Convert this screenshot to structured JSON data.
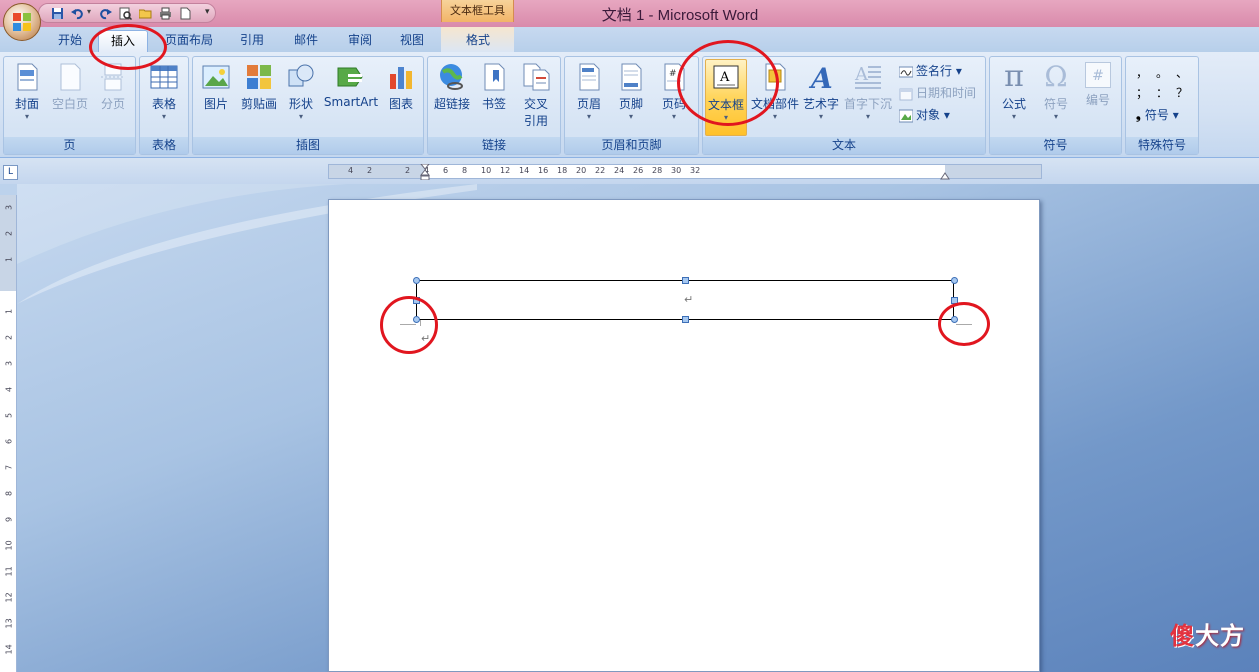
{
  "window": {
    "title": "文档 1 - Microsoft Word",
    "context_tools_label": "文本框工具"
  },
  "tabs": [
    {
      "label": "开始",
      "active": false
    },
    {
      "label": "插入",
      "active": true
    },
    {
      "label": "页面布局",
      "active": false
    },
    {
      "label": "引用",
      "active": false
    },
    {
      "label": "邮件",
      "active": false
    },
    {
      "label": "审阅",
      "active": false
    },
    {
      "label": "视图",
      "active": false
    },
    {
      "label": "格式",
      "active": false
    }
  ],
  "ribbon": {
    "groups": {
      "pages": {
        "label": "页",
        "buttons": [
          {
            "label": "封面",
            "icon": "cover-page-icon"
          },
          {
            "label": "空白页",
            "icon": "blank-page-icon",
            "disabled": true
          },
          {
            "label": "分页",
            "icon": "page-break-icon",
            "disabled": true
          }
        ]
      },
      "tables": {
        "label": "表格",
        "buttons": [
          {
            "label": "表格",
            "icon": "table-icon"
          }
        ]
      },
      "illustrations": {
        "label": "插图",
        "buttons": [
          {
            "label": "图片",
            "icon": "picture-icon"
          },
          {
            "label": "剪贴画",
            "icon": "clip-art-icon"
          },
          {
            "label": "形状",
            "icon": "shapes-icon"
          },
          {
            "label": "SmartArt",
            "icon": "smartart-icon"
          },
          {
            "label": "图表",
            "icon": "chart-icon"
          }
        ]
      },
      "links": {
        "label": "链接",
        "buttons": [
          {
            "label": "超链接",
            "icon": "hyperlink-icon"
          },
          {
            "label": "书签",
            "icon": "bookmark-icon"
          },
          {
            "label": "交叉",
            "label2": "引用",
            "icon": "cross-reference-icon"
          }
        ]
      },
      "header_footer": {
        "label": "页眉和页脚",
        "buttons": [
          {
            "label": "页眉",
            "icon": "header-icon"
          },
          {
            "label": "页脚",
            "icon": "footer-icon"
          },
          {
            "label": "页码",
            "icon": "page-number-icon"
          }
        ]
      },
      "text": {
        "label": "文本",
        "buttons": [
          {
            "label": "文本框",
            "icon": "text-box-icon",
            "highlighted": true
          },
          {
            "label": "文档部件",
            "icon": "quick-parts-icon"
          },
          {
            "label": "艺术字",
            "icon": "wordart-icon"
          },
          {
            "label": "首字下沉",
            "icon": "drop-cap-icon",
            "disabled": true
          }
        ],
        "small_buttons": [
          {
            "label": "签名行 ▾",
            "icon": "signature-line-icon"
          },
          {
            "label": "日期和时间",
            "icon": "date-time-icon",
            "disabled": true
          },
          {
            "label": "对象 ▾",
            "icon": "object-icon"
          }
        ]
      },
      "symbols": {
        "label": "符号",
        "buttons": [
          {
            "label": "公式",
            "icon": "equation-icon",
            "glyph": "π"
          },
          {
            "label": "符号",
            "icon": "symbol-icon",
            "glyph": "Ω",
            "disabled": true
          },
          {
            "label": "编号",
            "icon": "number-icon",
            "glyph": "#",
            "disabled": true
          }
        ]
      },
      "special_symbols": {
        "label": "特殊符号",
        "glyphs": [
          "，",
          "。",
          "、",
          "；",
          "：",
          "？"
        ],
        "symbol_button": "符号 ▾"
      }
    }
  },
  "ruler": {
    "button": "L",
    "h_ticks": [
      "4",
      "2",
      "",
      "2",
      "4",
      "6",
      "8",
      "10",
      "12",
      "14",
      "16",
      "18",
      "20",
      "22",
      "24",
      "26",
      "28",
      "30",
      "32"
    ],
    "v_ticks": [
      "3",
      "2",
      "1",
      "",
      "1",
      "2",
      "3",
      "4",
      "5",
      "6",
      "7",
      "8",
      "9",
      "10",
      "11",
      "12",
      "13",
      "14"
    ]
  },
  "document": {
    "paragraph_mark": "↵",
    "paragraph_mark2": "↵"
  },
  "watermark": {
    "first": "傻",
    "rest": "大方"
  },
  "colors": {
    "annotation_red": "#e1161f",
    "title_bar": "#d98aab",
    "context_tab": "#f2b468",
    "ribbon_text": "#15428b"
  }
}
